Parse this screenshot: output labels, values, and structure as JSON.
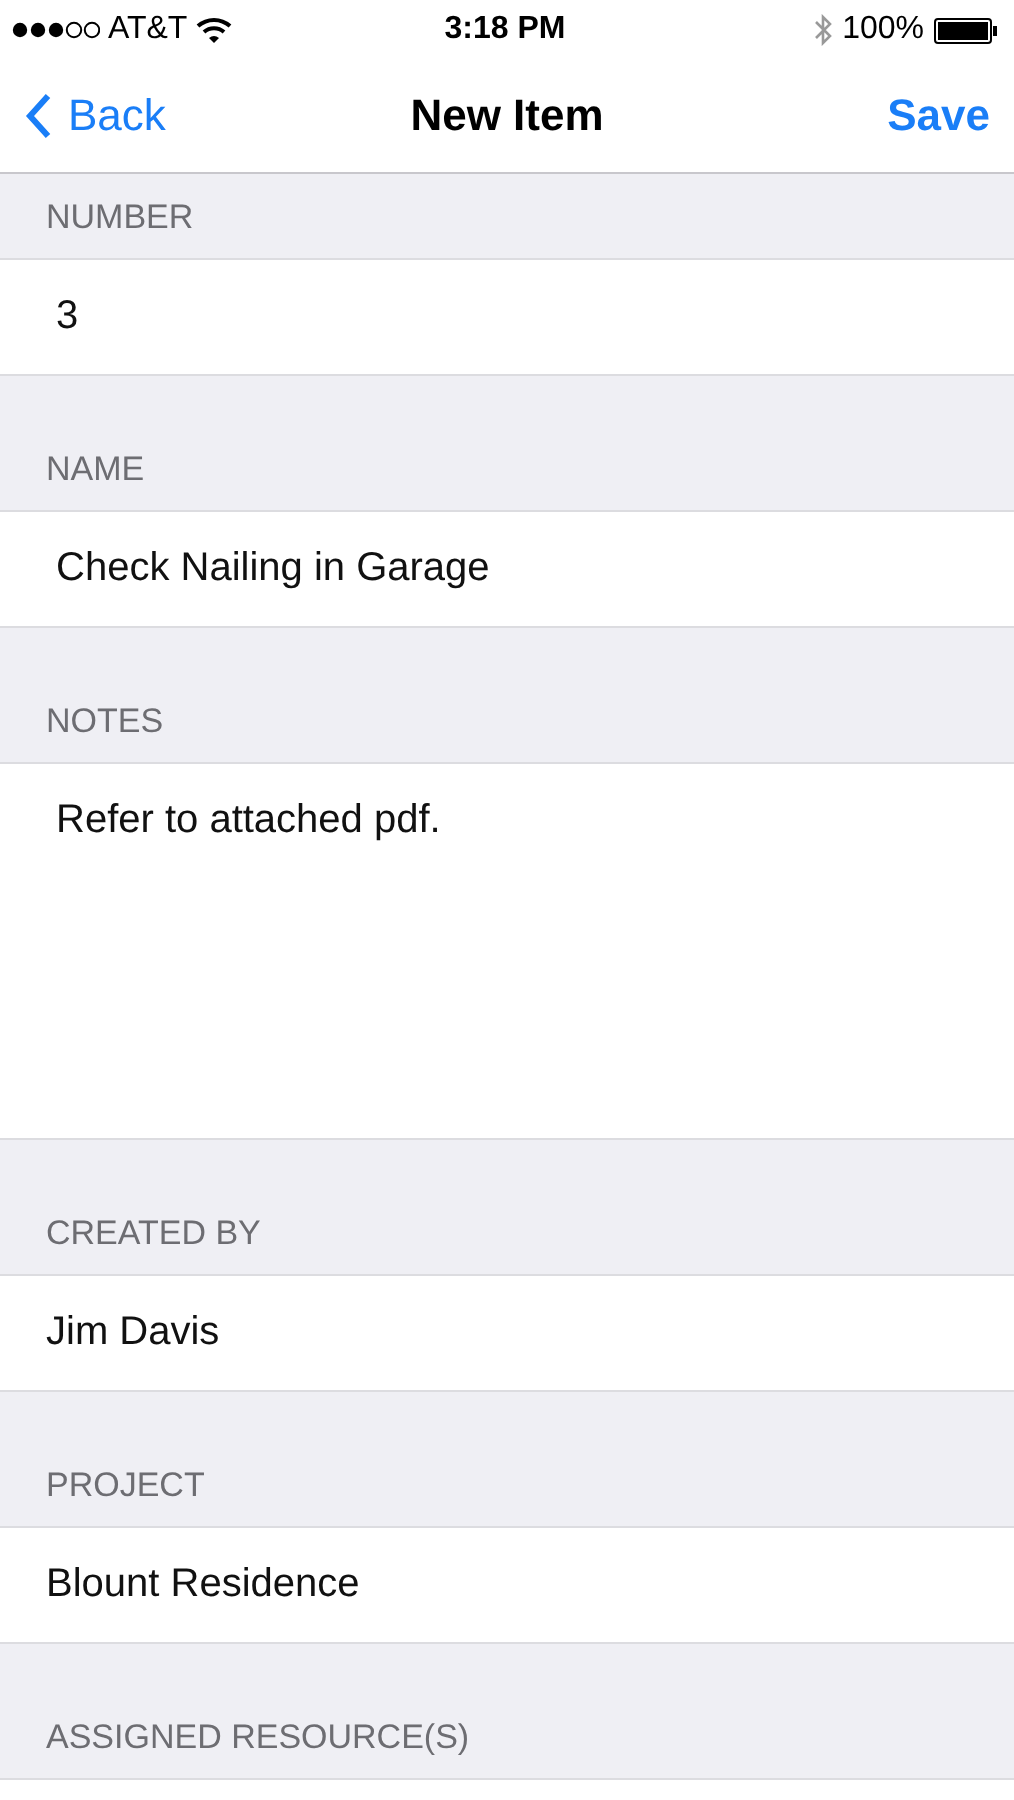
{
  "status_bar": {
    "carrier": "AT&T",
    "time": "3:18 PM",
    "battery": "100%"
  },
  "nav": {
    "back": "Back",
    "title": "New Item",
    "action": "Save"
  },
  "sections": [
    {
      "header": "NUMBER",
      "kind": "input",
      "value": "3"
    },
    {
      "header": "NAME",
      "kind": "input",
      "value": "Check Nailing in Garage"
    },
    {
      "header": "NOTES",
      "kind": "textarea",
      "value": "Refer to attached pdf."
    },
    {
      "header": "CREATED BY",
      "kind": "value",
      "value": "Jim Davis"
    },
    {
      "header": "PROJECT",
      "kind": "value",
      "value": "Blount Residence"
    },
    {
      "header": "ASSIGNED RESOURCE(S)"
    }
  ]
}
